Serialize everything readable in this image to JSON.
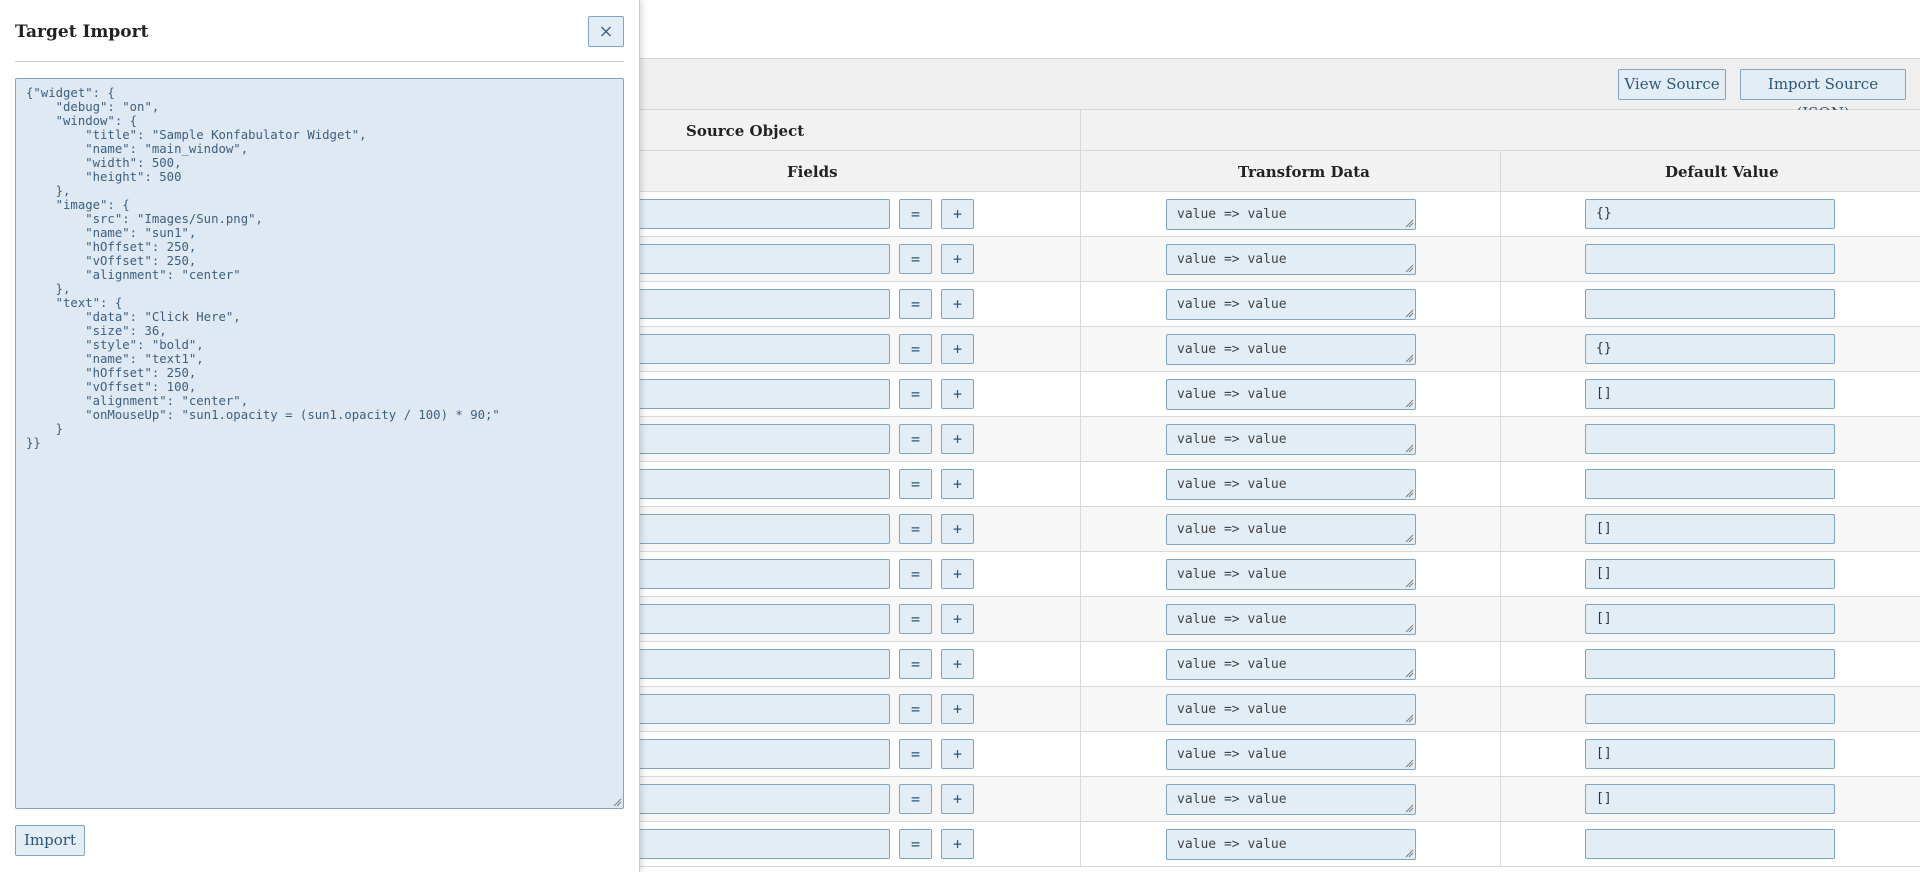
{
  "toolbar": {
    "view_source_label": "View Source",
    "import_source_label": "Import Source (JSON)"
  },
  "table": {
    "source_object_label": "Source Object",
    "columns": {
      "fields": "Fields",
      "transform": "Transform Data",
      "default": "Default Value"
    },
    "equals_symbol": "=",
    "plus_symbol": "+",
    "rows": [
      {
        "transform": "value => value",
        "default": "{}"
      },
      {
        "transform": "value => value",
        "default": ""
      },
      {
        "transform": "value => value",
        "default": ""
      },
      {
        "transform": "value => value",
        "default": "{}"
      },
      {
        "transform": "value => value",
        "default": "[]"
      },
      {
        "transform": "value => value",
        "default": ""
      },
      {
        "transform": "value => value",
        "default": ""
      },
      {
        "transform": "value => value",
        "default": "[]"
      },
      {
        "transform": "value => value",
        "default": "[]"
      },
      {
        "transform": "value => value",
        "default": "[]"
      },
      {
        "transform": "value => value",
        "default": ""
      },
      {
        "transform": "value => value",
        "default": ""
      },
      {
        "transform": "value => value",
        "default": "[]"
      },
      {
        "transform": "value => value",
        "default": "[]"
      },
      {
        "transform": "value => value",
        "default": ""
      }
    ]
  },
  "modal": {
    "title": "Target Import",
    "close_icon": "close-icon",
    "json_text": "{\"widget\": {\n    \"debug\": \"on\",\n    \"window\": {\n        \"title\": \"Sample Konfabulator Widget\",\n        \"name\": \"main_window\",\n        \"width\": 500,\n        \"height\": 500\n    },\n    \"image\": {\n        \"src\": \"Images/Sun.png\",\n        \"name\": \"sun1\",\n        \"hOffset\": 250,\n        \"vOffset\": 250,\n        \"alignment\": \"center\"\n    },\n    \"text\": {\n        \"data\": \"Click Here\",\n        \"size\": 36,\n        \"style\": \"bold\",\n        \"name\": \"text1\",\n        \"hOffset\": 250,\n        \"vOffset\": 100,\n        \"alignment\": \"center\",\n        \"onMouseUp\": \"sun1.opacity = (sun1.opacity / 100) * 90;\"\n    }\n}}",
    "import_label": "Import"
  },
  "colors": {
    "input_bg": "#e3edf6",
    "input_border": "#7fa4c4",
    "button_text": "#2d5677",
    "header_bg": "#f2f2f2"
  }
}
